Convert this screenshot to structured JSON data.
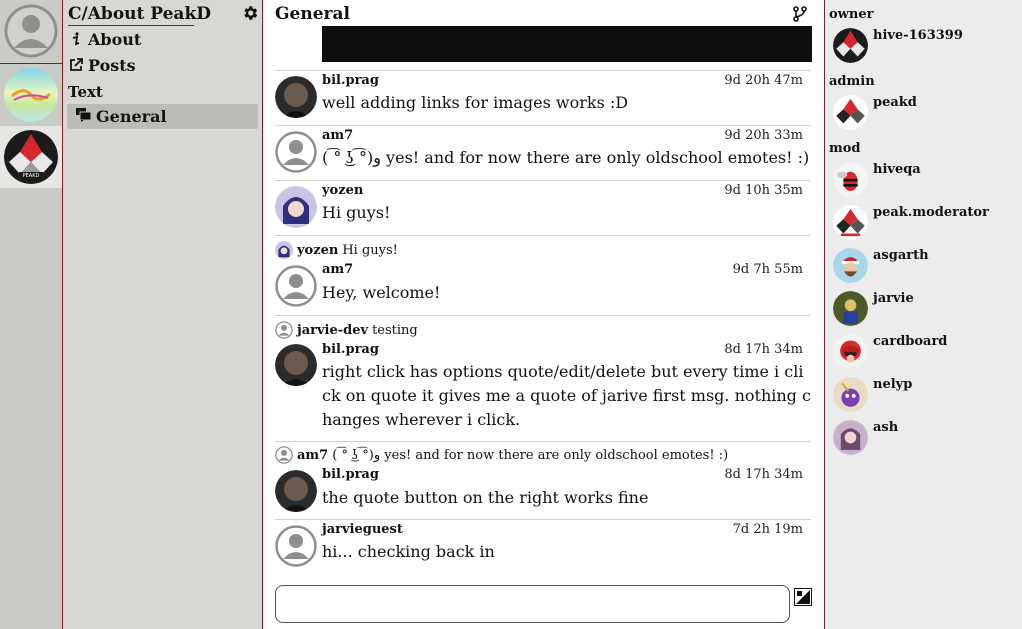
{
  "sidebar": {
    "community_title": "C/About PeakD",
    "nav": [
      {
        "label": "About",
        "icon": "info-icon"
      },
      {
        "label": "Posts",
        "icon": "external-link-icon"
      }
    ],
    "section_label": "Text",
    "channel": {
      "label": "General",
      "icon": "chat-bubbles-icon"
    }
  },
  "chat": {
    "channel_title": "General",
    "messages": [
      {
        "author": "bil.prag",
        "time": "9d 20h 47m",
        "text": "well adding links for images works :D"
      },
      {
        "author": "am7",
        "time": "9d 20h 33m",
        "text": "( ͡° ͜ʖ ͡°)و yes! and for now there are only oldschool emotes! :)"
      },
      {
        "author": "yozen",
        "time": "9d 10h 35m",
        "text": "Hi guys!"
      },
      {
        "author": "am7",
        "time": "9d 7h 55m",
        "text": "Hey, welcome!",
        "quote_author": "yozen",
        "quote_text": "Hi guys!"
      },
      {
        "author": "bil.prag",
        "time": "8d 17h 34m",
        "text": "right click has options quote/edit/delete but every time i click on quote it gives me a quote of jarive first msg. nothing changes wherever i click.",
        "quote_author": "jarvie-dev",
        "quote_text": "testing"
      },
      {
        "author": "bil.prag",
        "time": "8d 17h 34m",
        "text": "the quote button on the right works fine",
        "quote_author": "am7",
        "quote_text": "( ͡° ͜ʖ ͡°)و yes! and for now there are only oldschool emotes! :)"
      },
      {
        "author": "jarvieguest",
        "time": "7d 2h 19m",
        "text": "hi... checking back in"
      }
    ],
    "composer_placeholder": ""
  },
  "members": {
    "owner_label": "owner",
    "owner": [
      "hive-163399"
    ],
    "admin_label": "admin",
    "admin": [
      "peakd"
    ],
    "mod_label": "mod",
    "mod": [
      "hiveqa",
      "peak.moderator",
      "asgarth",
      "jarvie",
      "cardboard",
      "nelyp",
      "ash"
    ]
  },
  "colors": {
    "accent_border": "#8b1a1a",
    "rail_bg": "#c9cbc6",
    "sidebar_bg": "#d6d8d3",
    "active_channel_bg": "#babdb7",
    "members_bg": "#ececec"
  }
}
